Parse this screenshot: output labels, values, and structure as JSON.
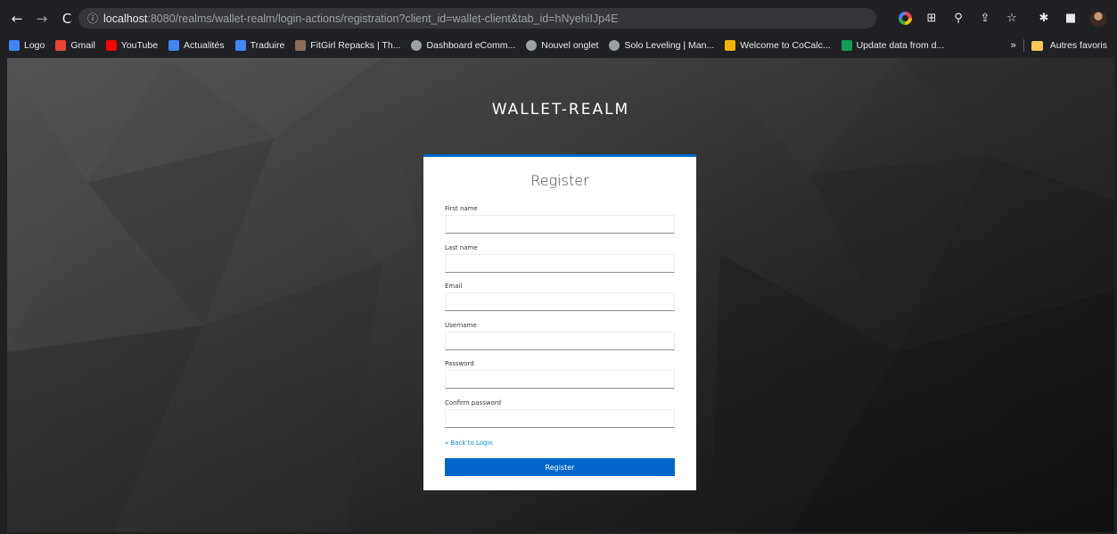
{
  "browser": {
    "url_info_icon": "info-icon",
    "url_host": "localhost",
    "url_rest": ":8080/realms/wallet-realm/login-actions/registration?client_id=wallet-client&tab_id=hNyehiIJp4E",
    "bookmarks": [
      {
        "label": "Logo",
        "color": "#4285f4",
        "icon": "apps-icon"
      },
      {
        "label": "Gmail",
        "color": "#ea4335",
        "icon": "gmail-icon"
      },
      {
        "label": "YouTube",
        "color": "#ff0000",
        "icon": "youtube-icon"
      },
      {
        "label": "Actualités",
        "color": "#4285f4",
        "icon": "news-icon"
      },
      {
        "label": "Traduire",
        "color": "#4285f4",
        "icon": "translate-icon"
      },
      {
        "label": "FitGirl Repacks | Th...",
        "color": "#8a6d5a",
        "icon": "fitgirl-icon"
      },
      {
        "label": "Dashboard eComm...",
        "color": "#9aa0a6",
        "icon": "globe-icon"
      },
      {
        "label": "Nouvel onglet",
        "color": "#9aa0a6",
        "icon": "globe-icon"
      },
      {
        "label": "Solo Leveling | Man...",
        "color": "#9aa0a6",
        "icon": "globe-icon"
      },
      {
        "label": "Welcome to CoCalc...",
        "color": "#f4b400",
        "icon": "cocalc-icon"
      },
      {
        "label": "Update data from d...",
        "color": "#0f9d58",
        "icon": "sheets-icon"
      }
    ],
    "more_bookmarks": "»",
    "other_bookmarks": "Autres favoris"
  },
  "realm": {
    "title": "WALLET-REALM"
  },
  "form": {
    "title": "Register",
    "fields": [
      {
        "label": "First name",
        "value": ""
      },
      {
        "label": "Last name",
        "value": ""
      },
      {
        "label": "Email",
        "value": ""
      },
      {
        "label": "Username",
        "value": ""
      },
      {
        "label": "Password",
        "value": ""
      },
      {
        "label": "Confirm password",
        "value": ""
      }
    ],
    "back_link": "« Back to Login",
    "submit_label": "Register"
  },
  "colors": {
    "accent": "#0066cc",
    "link": "#0088ce"
  }
}
